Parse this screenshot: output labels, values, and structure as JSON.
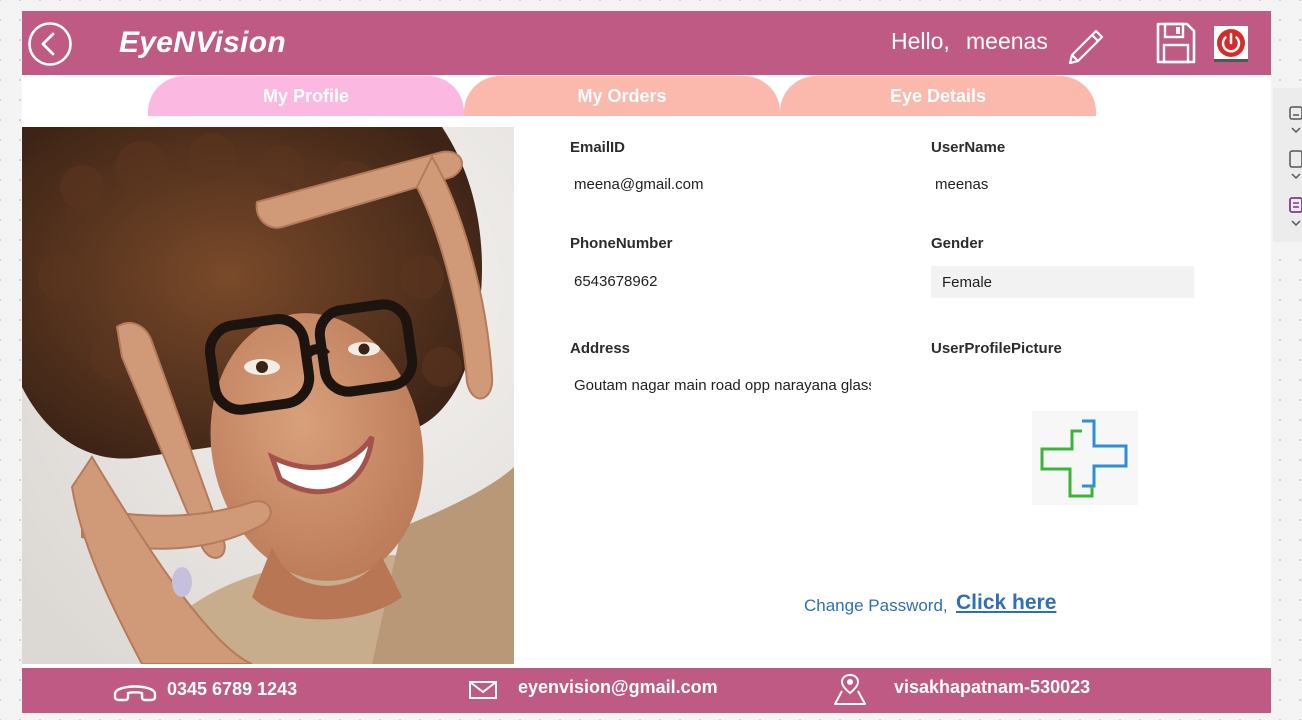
{
  "header": {
    "app_title": "EyeNVision",
    "greeting": "Hello,",
    "username": "meenas"
  },
  "tabs": [
    {
      "label": "My Profile",
      "active": true
    },
    {
      "label": "My Orders",
      "active": false
    },
    {
      "label": "Eye Details",
      "active": false
    }
  ],
  "profile": {
    "email": {
      "label": "EmailID",
      "value": "meena@gmail.com"
    },
    "username": {
      "label": "UserName",
      "value": "meenas"
    },
    "phone": {
      "label": "PhoneNumber",
      "value": "6543678962"
    },
    "gender": {
      "label": "Gender",
      "value": "Female"
    },
    "address": {
      "label": "Address",
      "value": "Goutam nagar main road opp narayana glass"
    },
    "picture": {
      "label": "UserProfilePicture"
    }
  },
  "change_password": {
    "prefix": "Change Password,",
    "link": "Click here"
  },
  "footer": {
    "phone": "0345 6789 1243",
    "email": "eyenvision@gmail.com",
    "location": "visakhapatnam-530023"
  },
  "colors": {
    "brand": "#bf5a84",
    "tab_active": "#fbb8e1",
    "tab_inactive": "#fbb8ac",
    "link": "#2f6fb7"
  },
  "icons": [
    "back-arrow-icon",
    "pencil-icon",
    "save-icon",
    "power-icon",
    "phone-icon",
    "mail-icon",
    "map-pin-icon",
    "medical-cross-icon"
  ]
}
